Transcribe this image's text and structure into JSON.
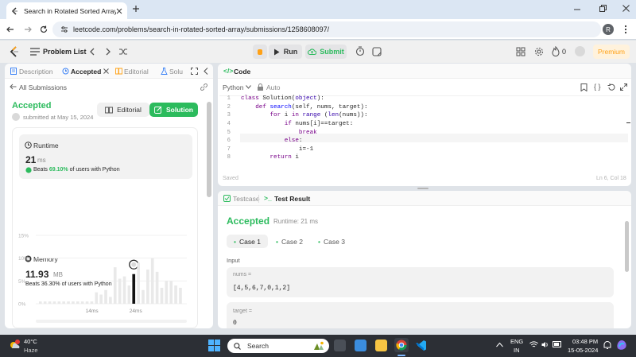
{
  "browser": {
    "tab_title": "Search in Rotated Sorted Array",
    "url": "leetcode.com/problems/search-in-rotated-sorted-array/submissions/1258608097/",
    "profile_initial": "R"
  },
  "topbar": {
    "problem_list": "Problem List",
    "run": "Run",
    "submit": "Submit",
    "streak": "0",
    "premium": "Premium",
    "accent": "#ffa116"
  },
  "left_tabs": {
    "description": "Description",
    "accepted": "Accepted",
    "editorial": "Editorial",
    "solutions": "Solu"
  },
  "submission": {
    "back": "All Submissions",
    "status": "Accepted",
    "submitted": "submitted at May 15, 2024",
    "editorial_btn": "Editorial",
    "solution_btn": "Solution",
    "runtime_label": "Runtime",
    "runtime_value": "21",
    "runtime_unit": "ms",
    "runtime_beats_pre": "Beats",
    "runtime_beats_pct": "69.10%",
    "runtime_beats_post": "of users with Python",
    "memory_label": "Memory",
    "memory_value": "11.93",
    "memory_unit": "MB",
    "memory_beats_pre": "Beats",
    "memory_beats_pct": "36.30%",
    "memory_beats_post": "of users with Python"
  },
  "chart_data": {
    "type": "bar",
    "y_ticks": [
      "15%",
      "10%",
      "5%",
      "0%"
    ],
    "ylim": [
      0,
      15
    ],
    "x_tick_labels": [
      "14ms",
      "24ms"
    ],
    "values": [
      0.5,
      0.5,
      0.5,
      0.5,
      0.5,
      0.5,
      0.5,
      0.5,
      0.5,
      0.5,
      0.5,
      0.5,
      2.5,
      2,
      3,
      1.5,
      8,
      5.5,
      6,
      4,
      6.5,
      9,
      3,
      7.5,
      10,
      7,
      3.5,
      5,
      5,
      4,
      3.5
    ],
    "highlight_index": 20,
    "highlight_value": 6.5,
    "bar_color": "#e9e9e9",
    "highlight_color": "#111111",
    "grid": true
  },
  "code": {
    "title": "Code",
    "language": "Python",
    "mode": "Auto",
    "lines": [
      "class Solution(object):",
      "    def search(self, nums, target):",
      "        for i in range (len(nums)):",
      "            if nums[i]==target:",
      "                break",
      "            else:",
      "                i=-1",
      "        return i"
    ],
    "status": "Saved",
    "cursor": "Ln 6, Col 18"
  },
  "test": {
    "testcase_tab": "Testcase",
    "result_tab": "Test Result",
    "status": "Accepted",
    "runtime": "Runtime: 21 ms",
    "cases": [
      "Case 1",
      "Case 2",
      "Case 3"
    ],
    "input_label": "Input",
    "var1_name": "nums =",
    "var1_value": "[4,5,6,7,0,1,2]",
    "var2_name": "target =",
    "var2_value": "0"
  },
  "taskbar": {
    "weather_temp": "40°C",
    "weather_desc": "Haze",
    "search": "Search",
    "lang_top": "ENG",
    "lang_bottom": "IN",
    "time": "03:48 PM",
    "date": "15-05-2024"
  }
}
